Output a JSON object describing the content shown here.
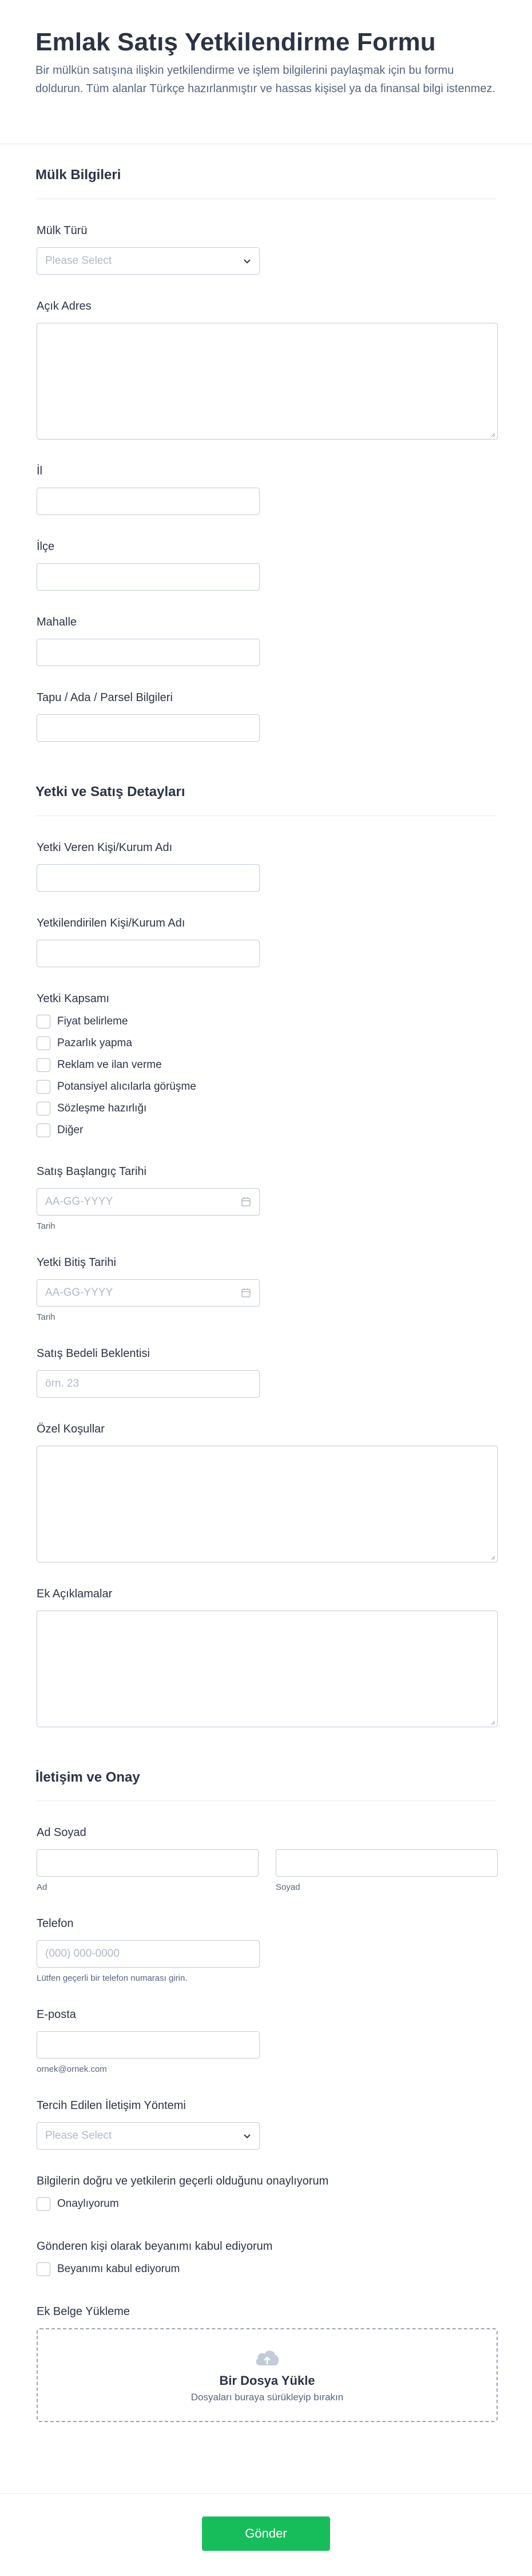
{
  "header": {
    "title": "Emlak Satış Yetkilendirme Formu",
    "description": "Bir mülkün satışına ilişkin yetkilendirme ve işlem bilgilerini paylaşmak için bu formu doldurun. Tüm alanlar Türkçe hazırlanmıştır ve hassas kişisel ya da finansal bilgi istenmez."
  },
  "section1": {
    "title": "Mülk Bilgileri",
    "property_type": {
      "label": "Mülk Türü",
      "placeholder": "Please Select"
    },
    "address": {
      "label": "Açık Adres"
    },
    "city": {
      "label": "İl"
    },
    "district": {
      "label": "İlçe"
    },
    "neighborhood": {
      "label": "Mahalle"
    },
    "deed": {
      "label": "Tapu / Ada / Parsel Bilgileri"
    }
  },
  "section2": {
    "title": "Yetki ve Satış Detayları",
    "grantor": {
      "label": "Yetki Veren Kişi/Kurum Adı"
    },
    "grantee": {
      "label": "Yetkilendirilen Kişi/Kurum Adı"
    },
    "scope": {
      "label": "Yetki Kapsamı",
      "options": [
        "Fiyat belirleme",
        "Pazarlık yapma",
        "Reklam ve ilan verme",
        "Potansiyel alıcılarla görüşme",
        "Sözleşme hazırlığı",
        "Diğer"
      ]
    },
    "start_date": {
      "label": "Satış Başlangıç Tarihi",
      "placeholder": "AA-GG-YYYY",
      "sublabel": "Tarih"
    },
    "end_date": {
      "label": "Yetki Bitiş Tarihi",
      "placeholder": "AA-GG-YYYY",
      "sublabel": "Tarih"
    },
    "price": {
      "label": "Satış Bedeli Beklentisi",
      "placeholder": "örn. 23"
    },
    "conditions": {
      "label": "Özel Koşullar"
    },
    "notes": {
      "label": "Ek Açıklamalar"
    }
  },
  "section3": {
    "title": "İletişim ve Onay",
    "name": {
      "label": "Ad Soyad",
      "first_sub": "Ad",
      "last_sub": "Soyad"
    },
    "phone": {
      "label": "Telefon",
      "placeholder": "(000) 000-0000",
      "sublabel": "Lütfen geçerli bir telefon numarası girin."
    },
    "email": {
      "label": "E-posta",
      "sublabel": "ornek@ornek.com"
    },
    "contact_method": {
      "label": "Tercih Edilen İletişim Yöntemi",
      "placeholder": "Please Select"
    },
    "confirm": {
      "label": "Bilgilerin doğru ve yetkilerin geçerli olduğunu onaylıyorum",
      "option": "Onaylıyorum"
    },
    "declaration": {
      "label": "Gönderen kişi olarak beyanımı kabul ediyorum",
      "option": "Beyanımı kabul ediyorum"
    },
    "upload": {
      "label": "Ek Belge Yükleme",
      "title": "Bir Dosya Yükle",
      "subtitle": "Dosyaları buraya sürükleyip bırakın"
    }
  },
  "submit": {
    "label": "Gönder"
  },
  "colors": {
    "accent": "#18bd5b",
    "text": "#2c3345",
    "border": "#c3cad8"
  },
  "icons": [
    "chevron-down-icon",
    "calendar-icon",
    "cloud-upload-icon",
    "resize-handle-icon"
  ]
}
